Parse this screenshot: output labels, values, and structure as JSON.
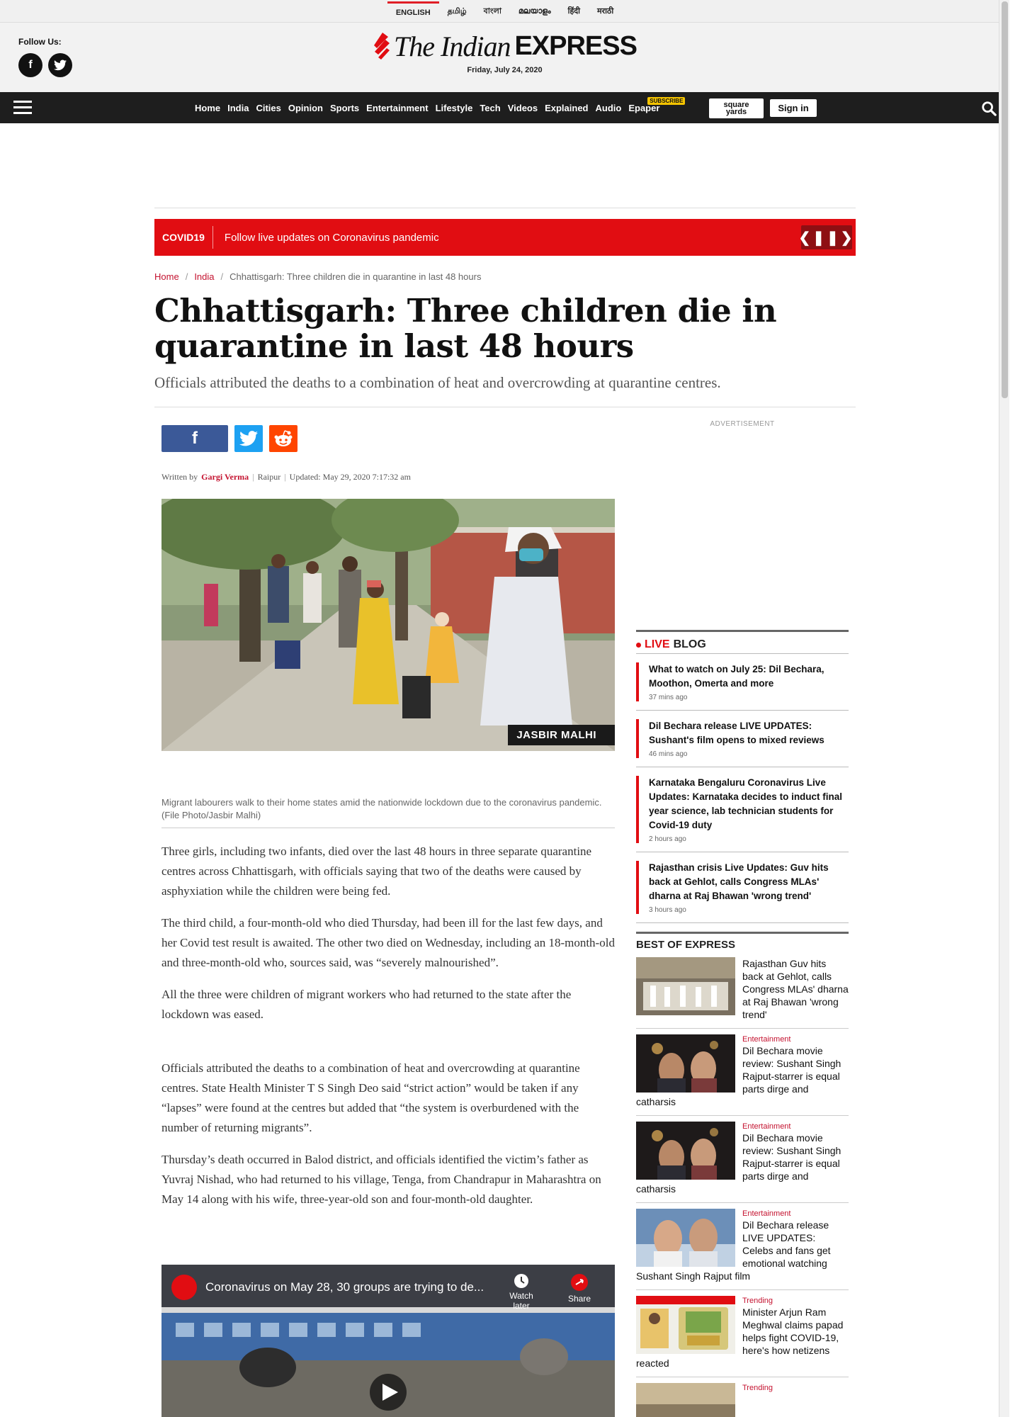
{
  "languages": [
    "ENGLISH",
    "தமிழ்",
    "বাংলা",
    "മലയാളം",
    "हिंदी",
    "मराठी"
  ],
  "masthead": {
    "follow_label": "Follow Us:",
    "logo_the": "The Indian",
    "logo_express": "EXPRESS",
    "date": "Friday, July 24, 2020"
  },
  "nav": {
    "items": [
      "Home",
      "India",
      "Cities",
      "Opinion",
      "Sports",
      "Entertainment",
      "Lifestyle",
      "Tech",
      "Videos",
      "Explained",
      "Audio",
      "Epaper"
    ],
    "subscribe_badge": "SUBSCRIBE",
    "square_yards_line1": "square",
    "square_yards_line2": "yards",
    "signin": "Sign in"
  },
  "covid_bar": {
    "tag": "COVID19",
    "message": "Follow live updates on Coronavirus pandemic"
  },
  "breadcrumb": {
    "home": "Home",
    "section": "India",
    "current": "Chhattisgarh: Three children die in quarantine in last 48 hours"
  },
  "article": {
    "headline": "Chhattisgarh: Three children die in quarantine in last 48 hours",
    "synopsis": "Officials attributed the deaths to a combination of heat and overcrowding at quarantine centres.",
    "byline_prefix": "Written by",
    "author": "Gargi Verma",
    "location": "Raipur",
    "updated": "Updated: May 29, 2020 7:17:32 am",
    "photo_credit": "JASBIR MALHI",
    "caption": "Migrant labourers walk to their home states amid the nationwide lockdown due to the coronavirus pandemic. (File Photo/Jasbir Malhi)",
    "paragraphs": [
      "Three girls, including two infants, died over the last 48 hours in three separate quarantine centres across Chhattisgarh, with officials saying that two of the deaths were caused by asphyxiation while the children were being fed.",
      "The third child, a four-month-old who died Thursday, had been ill for the last few days, and her Covid test result is awaited. The other two died on Wednesday, including an 18-month-old and three-month-old who, sources said, was “severely malnourished”.",
      "All the three were children of migrant workers who had returned to the state after the lockdown was eased.",
      "Officials attributed the deaths to a combination of heat and overcrowding at quarantine centres. State Health Minister T S Singh Deo said “strict action” would be taken if any “lapses” were found at the centres but added that “the system is overburdened with the number of returning migrants”.",
      "Thursday’s death occurred in Balod district, and officials identified the victim’s father as Yuvraj Nishad, who had returned to his village, Tenga, from Chandrapur in Maharashtra on May 14 along with his wife, three-year-old son and four-month-old daughter."
    ],
    "video": {
      "title": "Coronavirus on May 28, 30 groups are trying to de...",
      "watch_later": "Watch later",
      "share": "Share"
    }
  },
  "sidebar": {
    "ad_label": "ADVERTISEMENT",
    "live_label": "LIVE",
    "blog_label": "BLOG",
    "live_blog": [
      {
        "title": "What to watch on July 25: Dil Bechara, Moothon, Omerta and more",
        "ago": "37 mins ago"
      },
      {
        "title": "Dil Bechara release LIVE UPDATES: Sushant's film opens to mixed reviews",
        "ago": "46 mins ago"
      },
      {
        "title": "Karnataka Bengaluru Coronavirus Live Updates: Karnataka decides to induct final year science, lab technician students for Covid-19 duty",
        "ago": "2 hours ago"
      },
      {
        "title": "Rajasthan crisis Live Updates: Guv hits back at Gehlot, calls Congress MLAs' dharna at Raj Bhawan 'wrong trend'",
        "ago": "3 hours ago"
      }
    ],
    "best_label": "BEST OF EXPRESS",
    "best": [
      {
        "category": "",
        "title": "Rajasthan Guv hits back at Gehlot, calls Congress MLAs' dharna at Raj Bhawan 'wrong trend'"
      },
      {
        "category": "Entertainment",
        "title": "Dil Bechara movie review: Sushant Singh Rajput-starrer is equal parts dirge and catharsis"
      },
      {
        "category": "Entertainment",
        "title": "Dil Bechara movie review: Sushant Singh Rajput-starrer is equal parts dirge and catharsis"
      },
      {
        "category": "Entertainment",
        "title": "Dil Bechara release LIVE UPDATES: Celebs and fans get emotional watching Sushant Singh Rajput film"
      },
      {
        "category": "Trending",
        "title": "Minister Arjun Ram Meghwal claims papad helps fight COVID-19, here's how netizens reacted"
      },
      {
        "category": "Trending",
        "title": ""
      }
    ]
  },
  "colors": {
    "brand_red": "#e10d12",
    "link_red": "#c4122f",
    "nav_bg": "#1e1e1e"
  }
}
